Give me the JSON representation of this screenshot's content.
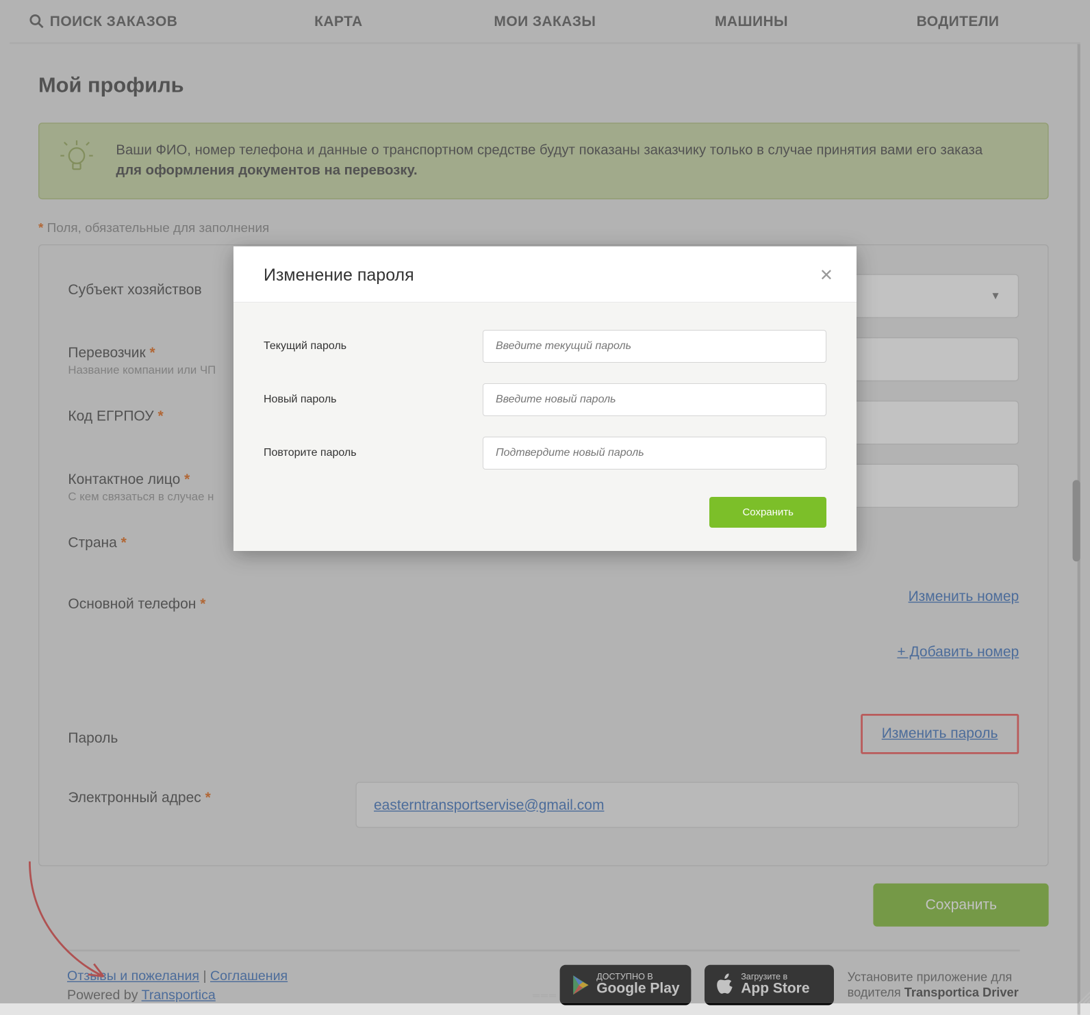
{
  "nav": {
    "search_orders": "ПОИСК ЗАКАЗОВ",
    "map": "КАРТА",
    "my_orders": "МОИ ЗАКАЗЫ",
    "vehicles": "МАШИНЫ",
    "drivers": "ВОДИТЕЛИ"
  },
  "page": {
    "title": "Мой профиль",
    "notice_line1": "Ваши ФИО, номер телефона и данные о транспортном средстве будут показаны заказчику только в случае принятия вами его заказа",
    "notice_bold": "для оформления документов на перевозку.",
    "required_note": "Поля, обязательные для заполнения"
  },
  "form": {
    "entity_label": "Субъект хозяйствов",
    "carrier_label": "Перевозчик",
    "carrier_sub": "Название компании или ЧП",
    "egrpou_label": "Код ЕГРПОУ",
    "contact_label": "Контактное лицо",
    "contact_sub": "С кем связаться в случае н",
    "country_label": "Страна",
    "phone_label": "Основной телефон",
    "change_number": "Изменить номер",
    "add_number": "+ Добавить номер",
    "password_label": "Пароль",
    "change_password": "Изменить пароль",
    "email_label": "Электронный адрес",
    "email_value": "easterntransportservise@gmail.com",
    "save": "Сохранить"
  },
  "modal": {
    "title": "Изменение пароля",
    "current_label": "Текущий пароль",
    "current_ph": "Введите текущий пароль",
    "new_label": "Новый пароль",
    "new_ph": "Введите новый пароль",
    "repeat_label": "Повторите пароль",
    "repeat_ph": "Подтвердите новый пароль",
    "save": "Сохранить"
  },
  "footer": {
    "feedback": "Отзывы и пожелания",
    "agreements": "Соглашения",
    "powered": "Powered by ",
    "brand": "Transportica",
    "gp_small": "ДОСТУПНО В",
    "gp_big": "Google Play",
    "as_small": "Загрузите в",
    "as_big": "App Store",
    "install_text": "Установите приложение для водителя ",
    "install_app": "Transportica Driver"
  }
}
